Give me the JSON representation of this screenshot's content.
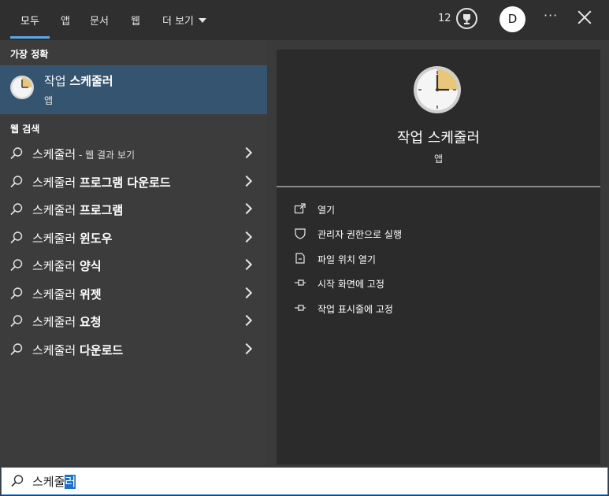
{
  "tabs": [
    "모두",
    "앱",
    "문서",
    "웹",
    "더 보기"
  ],
  "header": {
    "points": "12",
    "avatar_letter": "D",
    "more_label": "···"
  },
  "best_match": {
    "section_label": "가장 정확",
    "title_prefix": "작업 ",
    "title_bold": "스케줄러",
    "subtitle": "앱"
  },
  "web_search": {
    "section_label": "웹 검색",
    "items": [
      {
        "query": "스케줄러",
        "bold": "",
        "hint": " - 웹 결과 보기"
      },
      {
        "query": "스케줄러 ",
        "bold": "프로그램 다운로드",
        "hint": ""
      },
      {
        "query": "스케줄러 ",
        "bold": "프로그램",
        "hint": ""
      },
      {
        "query": "스케줄러 ",
        "bold": "윈도우",
        "hint": ""
      },
      {
        "query": "스케줄러 ",
        "bold": "양식",
        "hint": ""
      },
      {
        "query": "스케줄러 ",
        "bold": "위젯",
        "hint": ""
      },
      {
        "query": "스케줄러 ",
        "bold": "요청",
        "hint": ""
      },
      {
        "query": "스케줄러 ",
        "bold": "다운로드",
        "hint": ""
      }
    ]
  },
  "detail": {
    "app_title": "작업 스케줄러",
    "app_subtitle": "앱",
    "actions": [
      {
        "label": "열기",
        "icon": "open-icon"
      },
      {
        "label": "관리자 권한으로 실행",
        "icon": "shield-icon"
      },
      {
        "label": "파일 위치 열기",
        "icon": "file-location-icon"
      },
      {
        "label": "시작 화면에 고정",
        "icon": "pin-icon"
      },
      {
        "label": "작업 표시줄에 고정",
        "icon": "pin-icon"
      }
    ]
  },
  "search": {
    "typed": "스케줄",
    "selected": "러"
  },
  "colors": {
    "accent": "#5aa9e6",
    "selected_row": "#355470",
    "search_border": "#1f73c7"
  }
}
